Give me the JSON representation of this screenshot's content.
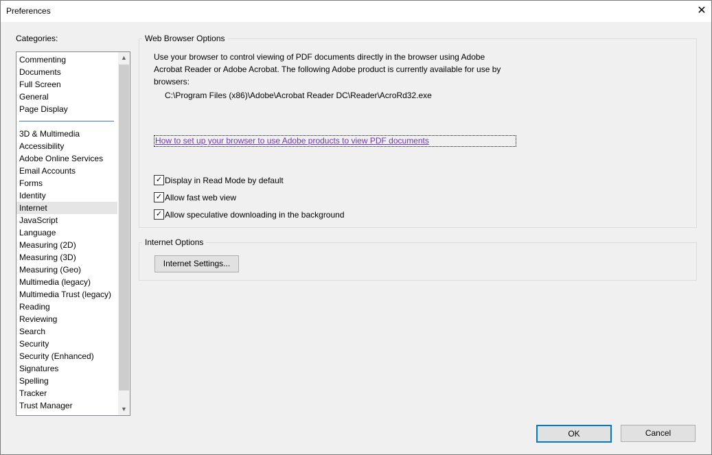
{
  "window": {
    "title": "Preferences",
    "close_glyph": "✕"
  },
  "categories": {
    "label": "Categories:",
    "group1": [
      "Commenting",
      "Documents",
      "Full Screen",
      "General",
      "Page Display"
    ],
    "group2": [
      "3D & Multimedia",
      "Accessibility",
      "Adobe Online Services",
      "Email Accounts",
      "Forms",
      "Identity",
      "Internet",
      "JavaScript",
      "Language",
      "Measuring (2D)",
      "Measuring (3D)",
      "Measuring (Geo)",
      "Multimedia (legacy)",
      "Multimedia Trust (legacy)",
      "Reading",
      "Reviewing",
      "Search",
      "Security",
      "Security (Enhanced)",
      "Signatures",
      "Spelling",
      "Tracker",
      "Trust Manager"
    ],
    "selected": "Internet",
    "scroll_up_icon": "▲",
    "scroll_down_icon": "▼"
  },
  "web_browser_options": {
    "title": "Web Browser Options",
    "description": "Use your browser to control viewing of PDF documents directly in the browser using Adobe Acrobat Reader or Adobe Acrobat. The following Adobe product is currently available for use by browsers:",
    "product_path": "C:\\Program Files (x86)\\Adobe\\Acrobat Reader DC\\Reader\\AcroRd32.exe",
    "help_link": "How to set up your browser to use Adobe products to view PDF documents",
    "checkboxes": [
      {
        "label": "Display in Read Mode by default",
        "checked": true
      },
      {
        "label": "Allow fast web view",
        "checked": true
      },
      {
        "label": "Allow speculative downloading in the background",
        "checked": true
      }
    ]
  },
  "internet_options": {
    "title": "Internet Options",
    "settings_button": "Internet Settings..."
  },
  "footer": {
    "ok": "OK",
    "cancel": "Cancel"
  },
  "colors": {
    "link": "#6a39b5",
    "accent": "#0078d7",
    "separator": "#3b78b5"
  },
  "icons": {
    "check": "✓"
  }
}
